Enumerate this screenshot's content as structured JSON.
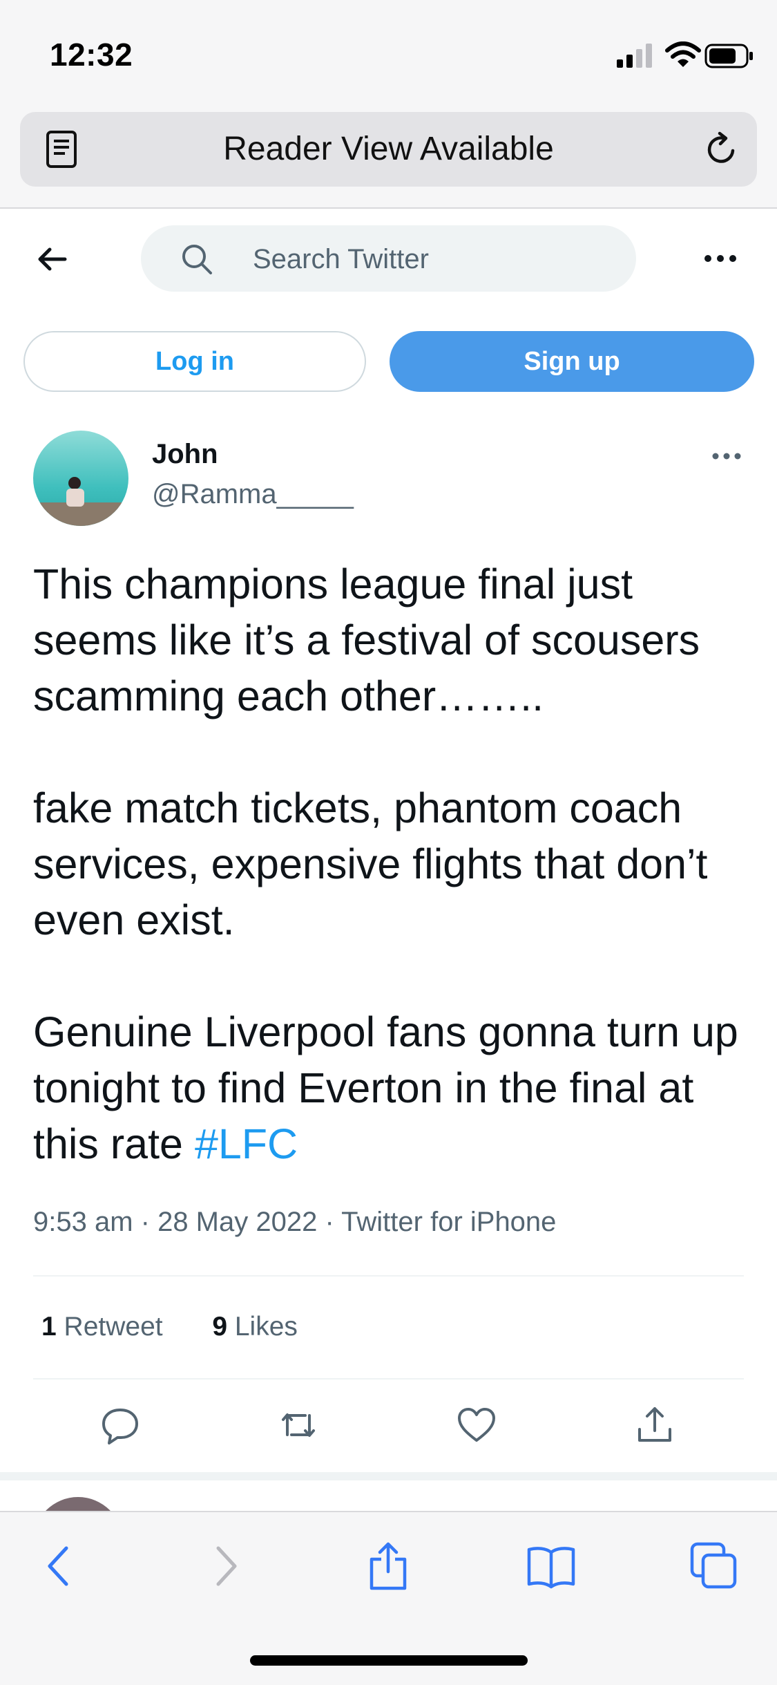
{
  "status_bar": {
    "time": "12:32"
  },
  "browser": {
    "reader_title": "Reader View Available"
  },
  "header": {
    "search_placeholder": "Search Twitter"
  },
  "auth": {
    "login_label": "Log in",
    "signup_label": "Sign up"
  },
  "tweet": {
    "display_name": "John",
    "handle": "@Ramma_____",
    "text_para1": "This champions league final just seems like it’s a festival of scousers scamming each other……..",
    "text_para2": "fake match tickets, phantom coach services, expensive flights that don’t even exist.",
    "text_para3": "Genuine Liverpool fans gonna turn up tonight to find Everton in the final at this rate ",
    "hashtag": "#LFC",
    "timestamp": "9:53 am · 28 May 2022 · Twitter for iPhone",
    "retweets_count": "1",
    "retweets_label": "Retweet",
    "likes_count": "9",
    "likes_label": "Likes"
  },
  "colors": {
    "accent": "#1d9bf0",
    "signup_bg": "#4a9ae9",
    "safari_icon": "#3478f6"
  },
  "icons": [
    "reader-icon",
    "reload-icon",
    "back-arrow-icon",
    "search-icon",
    "more-icon",
    "reply-icon",
    "retweet-icon",
    "like-icon",
    "share-icon",
    "safari-back-icon",
    "safari-forward-icon",
    "safari-share-icon",
    "bookmarks-icon",
    "tabs-icon"
  ]
}
